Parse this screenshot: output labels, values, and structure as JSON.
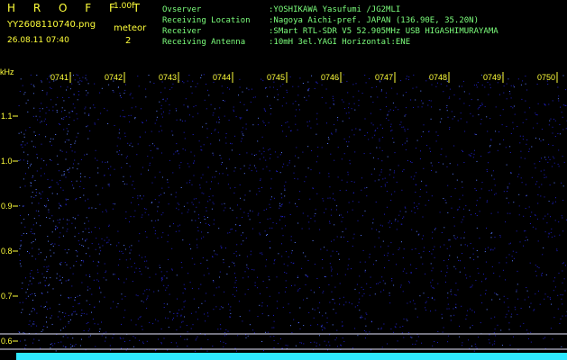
{
  "header": {
    "brand": "H R O F F T",
    "version": "1.00f",
    "filename": "YY2608110740.png",
    "datetime": "26.08.11 07:40",
    "meteor_label": "meteor",
    "meteor_count": "2"
  },
  "station": {
    "observer_key": "Ovserver",
    "observer_val": ":YOSHIKAWA Yasufumi /JG2MLI",
    "location_key": "Receiving Location",
    "location_val": ":Nagoya Aichi-pref. JAPAN (136.90E, 35.20N)",
    "receiver_key": "Receiver",
    "receiver_val": ":SMart RTL-SDR V5 52.905MHz USB HIGASHIMURAYAMA",
    "antenna_key": "Receiving Antenna",
    "antenna_val": ":10mH 3el.YAGI Horizontal:ENE"
  },
  "freq_axis": {
    "unit": "kHz",
    "ticks": [
      "1.1",
      "1.0",
      "0.9",
      "0.8",
      "0.7",
      "0.6"
    ]
  },
  "time_axis": {
    "ticks": [
      "0741",
      "0742",
      "0743",
      "0744",
      "0745",
      "0746",
      "0747",
      "0748",
      "0749",
      "0750"
    ]
  },
  "colors": {
    "background": "#000000",
    "header_text": "#ffff3a",
    "station_text": "#7cff7c",
    "noise": "#2020c8",
    "noise_hot": "#5a7aff",
    "baseline": "#2fe8ff",
    "marker_line": "#e8e8ff"
  }
}
